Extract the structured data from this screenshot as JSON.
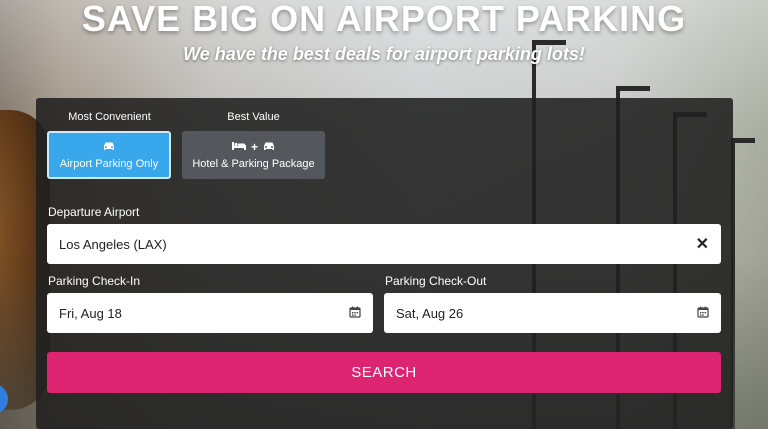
{
  "hero": {
    "title": "SAVE BIG ON AIRPORT PARKING",
    "subtitle": "We have the best deals for airport parking lots!"
  },
  "options": [
    {
      "caption": "Most Convenient",
      "label": "Airport Parking Only",
      "icon": "car-icon",
      "selected": true
    },
    {
      "caption": "Best Value",
      "label": "Hotel & Parking Package",
      "icons": [
        "bed-icon",
        "car-icon"
      ],
      "plus": "+",
      "selected": false
    }
  ],
  "departure": {
    "label": "Departure Airport",
    "value": "Los Angeles (LAX)",
    "clear_icon": "close-icon",
    "clear_glyph": "✕"
  },
  "checkin": {
    "label": "Parking Check-In",
    "value": "Fri, Aug 18",
    "icon": "calendar-icon"
  },
  "checkout": {
    "label": "Parking Check-Out",
    "value": "Sat, Aug 26",
    "icon": "calendar-icon"
  },
  "search": {
    "label": "SEARCH"
  },
  "colors": {
    "accent": "#dd2471",
    "selected_option": "#39a7ec",
    "unselected_option": "#54575c",
    "panel": "#202020"
  }
}
